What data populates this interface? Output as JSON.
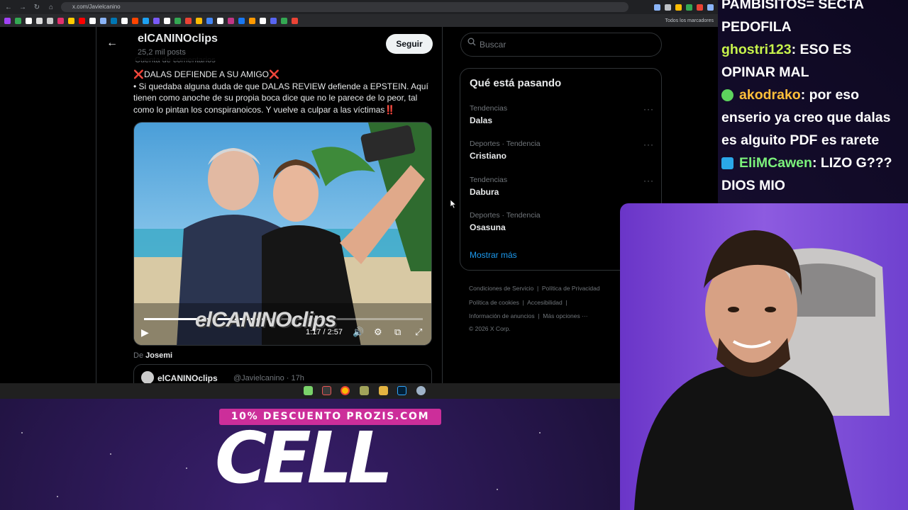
{
  "browser": {
    "url": "x.com/Javielcanino",
    "bookmarks_folder": "Todos los marcadores"
  },
  "profile": {
    "back_icon": "arrow-left-icon",
    "name": "elCANINOclips",
    "post_count": "25,2 mil posts",
    "follow_label": "Seguir",
    "account_label": "Cuenta de comentarios"
  },
  "post": {
    "line1": "❌DALAS DEFIENDE A SU AMIGO❌",
    "line2": "• Si quedaba alguna duda de que DALAS REVIEW defiende a EPSTEIN. Aquí tienen como anoche de su propia boca dice que no le parece de lo peor, tal como lo pintan los conspiranoicos. Y vuelve a culpar a las víctimas‼️",
    "video": {
      "watermark": "elCANINOclips",
      "time": "1:17 / 2:57",
      "progress": 0.435
    },
    "from_prefix": "De",
    "from_name": "Josemi",
    "quoted": {
      "name": "elCANINOclips",
      "handle": "@Javielcanino · 17h"
    }
  },
  "search": {
    "placeholder": "Buscar"
  },
  "trends": {
    "title": "Qué está pasando",
    "items": [
      {
        "category": "Tendencias",
        "name": "Dalas"
      },
      {
        "category": "Deportes · Tendencia",
        "name": "Cristiano"
      },
      {
        "category": "Tendencias",
        "name": "Dabura"
      },
      {
        "category": "Deportes · Tendencia",
        "name": "Osasuna"
      }
    ],
    "show_more": "Mostrar más"
  },
  "footer": {
    "terms": "Condiciones de Servicio",
    "privacy": "Política de Privacidad",
    "cookies": "Política de cookies",
    "accessibility": "Accesibilidad",
    "ads": "Información de anuncios",
    "more": "Más opciones ···",
    "copyright": "© 2026 X Corp."
  },
  "chat": {
    "line0": "PAMBISITOS= SECTA PEDOFILA",
    "m1_user": "ghostri123",
    "m1_text": ": ESO ES OPINAR MAL",
    "m2_user": "akodrako",
    "m2_text": ": por eso enserio ya creo que dalas es alguito PDF es rarete",
    "m3_user": "EliMCawen",
    "m3_text": ": LIZO G??? DIOS MIO"
  },
  "promo": {
    "bar": "10% DESCUENTO PROZIS.COM",
    "big": "CELL"
  }
}
